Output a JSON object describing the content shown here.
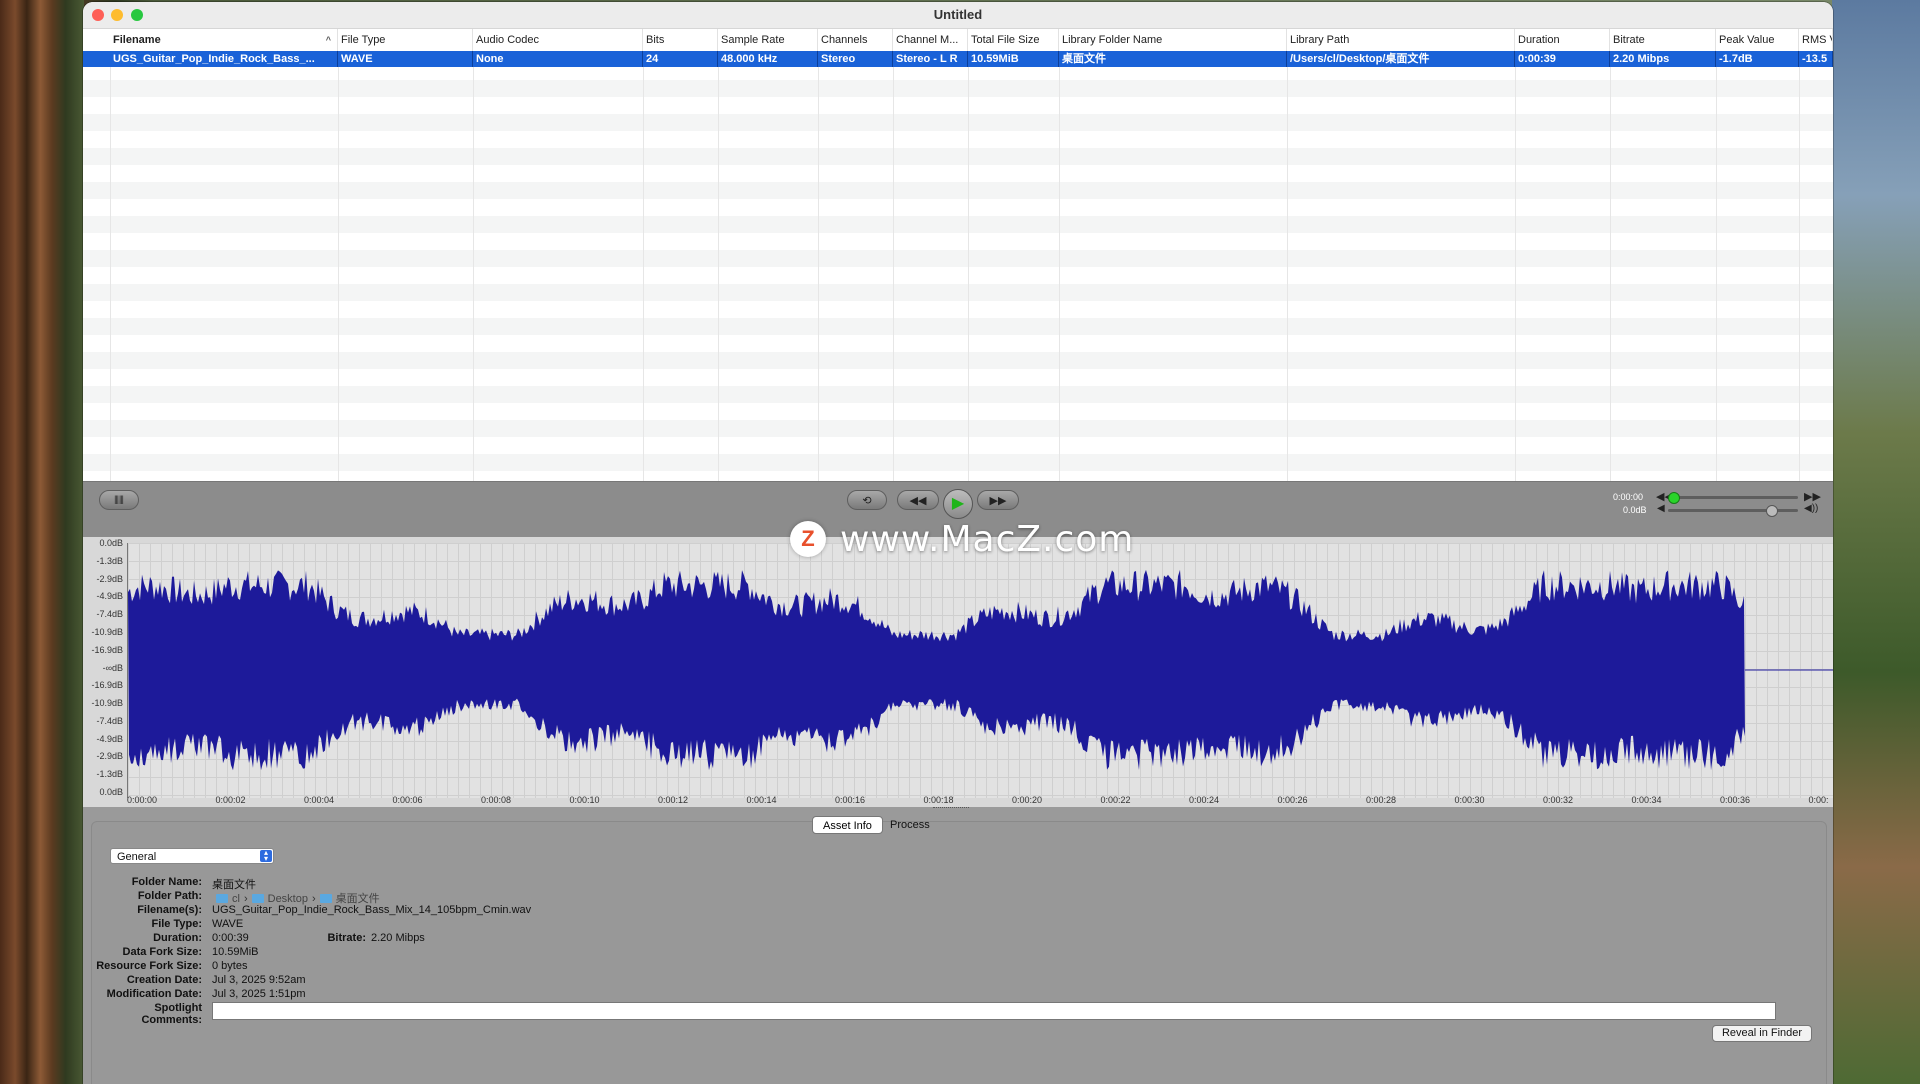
{
  "window": {
    "title": "Untitled"
  },
  "table": {
    "columns": [
      "Filename",
      "File Type",
      "Audio Codec",
      "Bits",
      "Sample Rate",
      "Channels",
      "Channel M...",
      "Total File Size",
      "Library Folder Name",
      "Library Path",
      "Duration",
      "Bitrate",
      "Peak Value",
      "RMS V"
    ],
    "rows": [
      [
        "UGS_Guitar_Pop_Indie_Rock_Bass_...",
        "WAVE",
        "None",
        "24",
        "48.000 kHz",
        "Stereo",
        "Stereo - L R",
        "10.59MiB",
        "桌面文件",
        "/Users/cl/Desktop/桌面文件",
        "0:00:39",
        "2.20 Mibps",
        "-1.7dB",
        "-13.5"
      ]
    ],
    "sort_indicator": "^"
  },
  "transport": {
    "position": "0:00:00",
    "volume": "0.0dB",
    "position_level": 0.0,
    "volume_level": 0.75
  },
  "waveform": {
    "y_labels": [
      "0.0dB",
      "-1.3dB",
      "-2.9dB",
      "-4.9dB",
      "-7.4dB",
      "-10.9dB",
      "-16.9dB",
      "-∞dB",
      "-16.9dB",
      "-10.9dB",
      "-7.4dB",
      "-4.9dB",
      "-2.9dB",
      "-1.3dB",
      "0.0dB"
    ],
    "x_labels": [
      "0:00:00",
      "0:00:02",
      "0:00:04",
      "0:00:06",
      "0:00:08",
      "0:00:10",
      "0:00:12",
      "0:00:14",
      "0:00:16",
      "0:00:18",
      "0:00:20",
      "0:00:22",
      "0:00:24",
      "0:00:26",
      "0:00:28",
      "0:00:30",
      "0:00:32",
      "0:00:34",
      "0:00:36",
      "0:00:"
    ],
    "color": "#1d1a9a"
  },
  "watermark": {
    "logo": "Z",
    "text": "www.MacZ.com"
  },
  "info": {
    "tabs": [
      "Asset Info",
      "Process"
    ],
    "active_tab": "Asset Info",
    "dropdown": "General",
    "fields": {
      "folder_name_label": "Folder Name:",
      "folder_name": "桌面文件",
      "folder_path_label": "Folder Path:",
      "folder_path": [
        "cl",
        "Desktop",
        "桌面文件"
      ],
      "filenames_label": "Filename(s):",
      "filenames": "UGS_Guitar_Pop_Indie_Rock_Bass_Mix_14_105bpm_Cmin.wav",
      "file_type_label": "File Type:",
      "file_type": "WAVE",
      "duration_label": "Duration:",
      "duration": "0:00:39",
      "bitrate_label": "Bitrate:",
      "bitrate": "2.20 Mibps",
      "data_fork_label": "Data Fork Size:",
      "data_fork": "10.59MiB",
      "resource_fork_label": "Resource Fork Size:",
      "resource_fork": "0 bytes",
      "creation_label": "Creation Date:",
      "creation": "Jul 3, 2025 9:52am",
      "modification_label": "Modification Date:",
      "modification": "Jul 3, 2025 1:51pm",
      "comments_label": "Spotlight Comments:",
      "comments": ""
    },
    "reveal_button": "Reveal in Finder"
  }
}
